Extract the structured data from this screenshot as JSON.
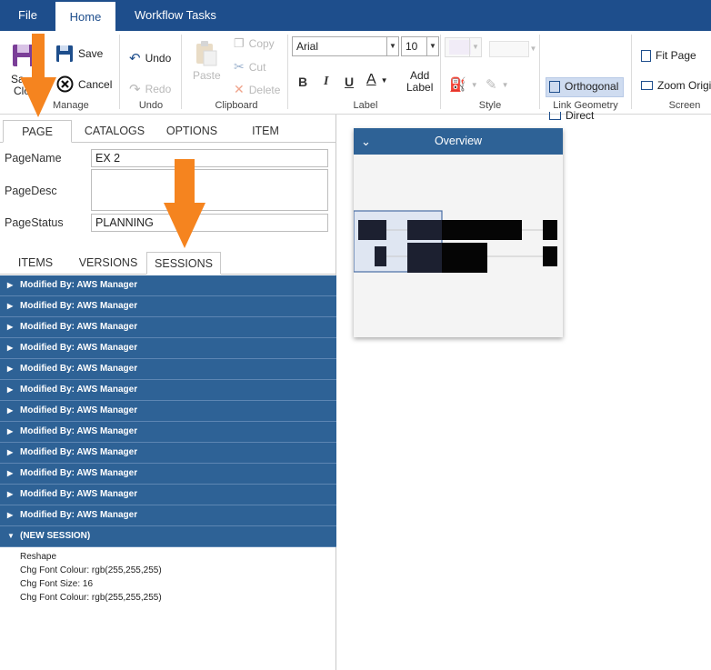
{
  "menu": {
    "file": "File",
    "home": "Home",
    "workflow": "Workflow Tasks"
  },
  "ribbon": {
    "manage": {
      "save_close": "Save & Close",
      "save_close_line1": "Sa",
      "save_close_line2": "Clo",
      "save": "Save",
      "cancel": "Cancel",
      "label": "Manage"
    },
    "undo": {
      "undo": "Undo",
      "redo": "Redo",
      "label": "Undo"
    },
    "clipboard": {
      "paste": "Paste",
      "copy": "Copy",
      "cut": "Cut",
      "delete": "Delete",
      "label": "Clipboard"
    },
    "label_group": {
      "font": "Arial",
      "size": "10",
      "bold": "B",
      "italic": "I",
      "underline": "U",
      "font_colour": "A",
      "add_label_1": "Add",
      "add_label_2": "Label",
      "label": "Label"
    },
    "style": {
      "label": "Style"
    },
    "link_geometry": {
      "orthogonal": "Orthogonal",
      "direct": "Direct",
      "label": "Link Geometry"
    },
    "screen": {
      "fit_page": "Fit Page",
      "zoom": "Zoom Origi",
      "label": "Screen"
    }
  },
  "left": {
    "tabs": [
      "PAGE",
      "CATALOGS",
      "OPTIONS",
      "ITEM"
    ],
    "fields": {
      "page_name_label": "PageName",
      "page_name": "EX 2",
      "page_desc_label": "PageDesc",
      "page_desc": "",
      "page_status_label": "PageStatus",
      "page_status": "PLANNING"
    },
    "sub_tabs": [
      "ITEMS",
      "VERSIONS",
      "SESSIONS"
    ],
    "sessions": [
      "Modified By: AWS Manager",
      "Modified By: AWS Manager",
      "Modified By: AWS Manager",
      "Modified By: AWS Manager",
      "Modified By: AWS Manager",
      "Modified By: AWS Manager",
      "Modified By: AWS Manager",
      "Modified By: AWS Manager",
      "Modified By: AWS Manager",
      "Modified By: AWS Manager",
      "Modified By: AWS Manager",
      "Modified By: AWS Manager"
    ],
    "new_session": "(NEW SESSION)",
    "new_session_details": [
      "Reshape",
      "Chg Font Colour: rgb(255,255,255)",
      "Chg Font Size: 16",
      "Chg Font Colour: rgb(255,255,255)"
    ]
  },
  "overview": {
    "title": "Overview"
  },
  "colors": {
    "brand": "#1e4e8c",
    "session_row": "#2e6296",
    "highlight_arrow": "#f5841f"
  }
}
